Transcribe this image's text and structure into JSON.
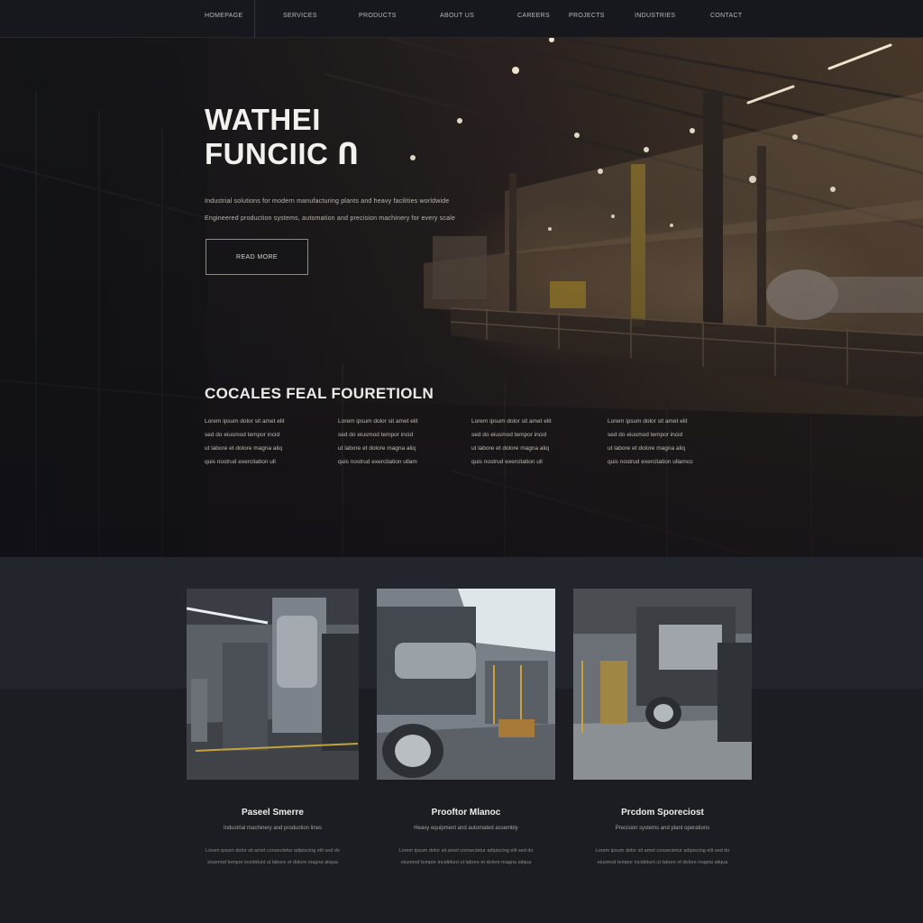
{
  "nav": {
    "items": [
      "HOMEPAGE",
      "SERVICES",
      "PRODUCTS",
      "ABOUT US",
      "CAREERS",
      "PROJECTS",
      "INDUSTRIES",
      "CONTACT"
    ]
  },
  "hero": {
    "title_line1": "WATHEI",
    "title_line2": "FUNCIIC Ո",
    "subtitle_line1": "Industrial solutions for modern manufacturing plants and heavy facilities worldwide",
    "subtitle_line2": "Engineered production systems, automation and precision machinery for every scale",
    "button_label": "READ MORE"
  },
  "features": {
    "heading": "COCALES FEAL FOURETIOLN",
    "columns": [
      [
        "Lorem ipsum dolor sit amet elit",
        "sed do eiusmod tempor incid",
        "ut labore et dolore magna aliq",
        "quis nostrud exercitation ull"
      ],
      [
        "Lorem ipsum dolor sit amet elit",
        "sed do eiusmod tempor incid",
        "ut labore et dolore magna aliq",
        "quis nostrud exercitation ullam"
      ],
      [
        "Lorem ipsum dolor sit amet elit",
        "sed do eiusmod tempor incid",
        "ut labore et dolore magna aliq",
        "quis nostrud exercitation ull"
      ],
      [
        "Lorem ipsum dolor sit amet elit",
        "sed do eiusmod tempor incid",
        "ut labore et dolore magna aliq",
        "quis nostrud exercitation ullamco"
      ]
    ]
  },
  "cards": [
    {
      "title": "Paseel Smerre",
      "subtitle": "Industrial machinery and production lines",
      "desc_line1": "Lorem ipsum dolor sit amet consectetur adipiscing elit sed do",
      "desc_line2": "eiusmod tempor incididunt ut labore et dolore magna aliqua"
    },
    {
      "title": "Prooftor Mlanoc",
      "subtitle": "Heavy equipment and automated assembly",
      "desc_line1": "Lorem ipsum dolor sit amet consectetur adipiscing elit sed do",
      "desc_line2": "eiusmod tempor incididunt ut labore et dolore magna aliqua"
    },
    {
      "title": "Prcdom Sporeciost",
      "subtitle": "Precision systems and plant operations",
      "desc_line1": "Lorem ipsum dolor sit amet consectetur adipiscing elit sed do",
      "desc_line2": "eiusmod tempor incididunt ut labore et dolore magna aliqua"
    }
  ]
}
